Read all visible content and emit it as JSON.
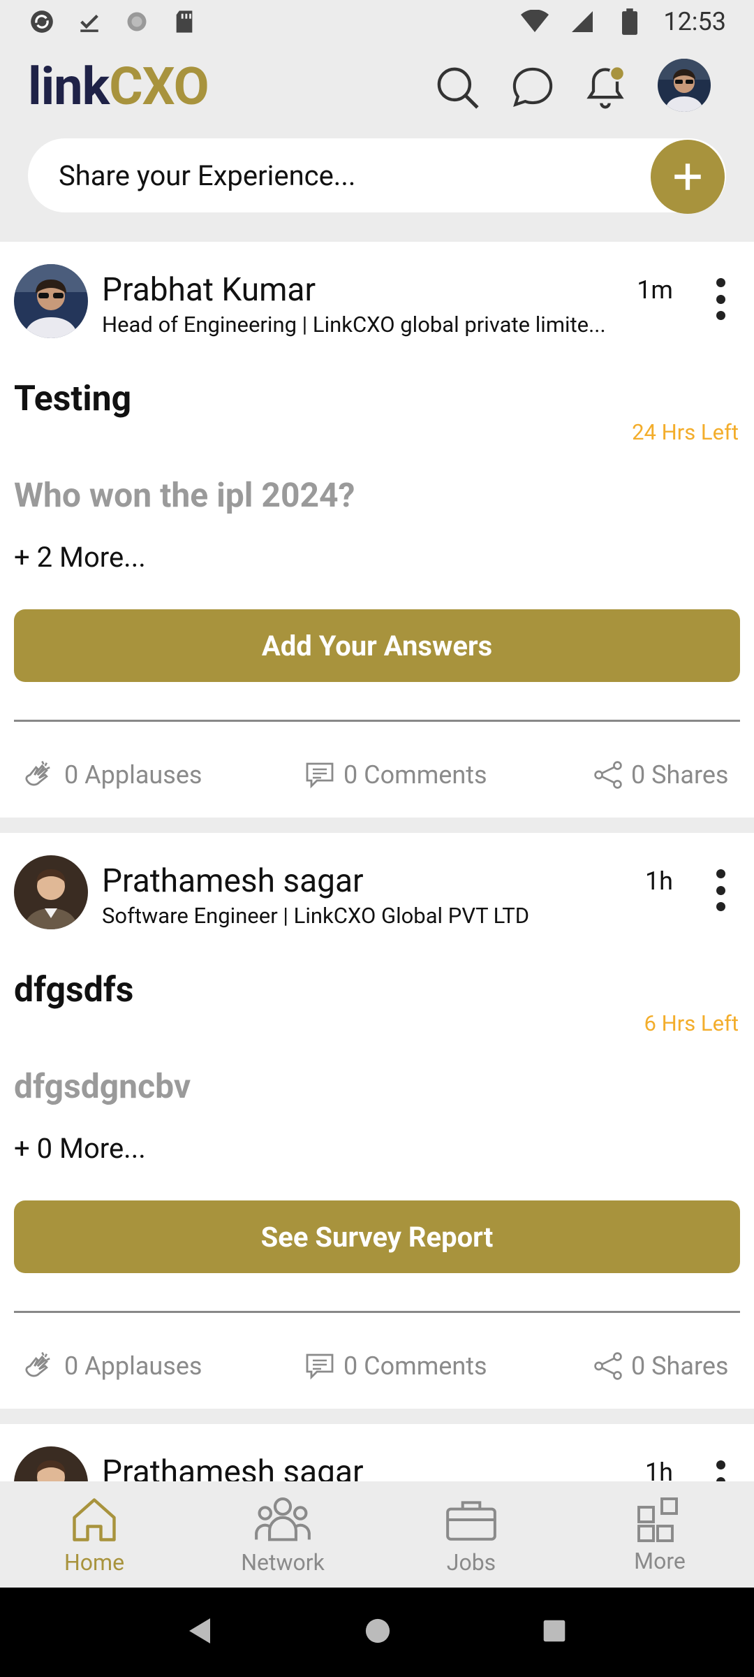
{
  "status_bar": {
    "time": "12:53"
  },
  "header": {
    "logo_left": "link",
    "logo_right": "CXO"
  },
  "share": {
    "placeholder": "Share your Experience..."
  },
  "posts": [
    {
      "author": "Prabhat Kumar",
      "role": "Head of Engineering | LinkCXO global private limite...",
      "ago": "1m",
      "title": "Testing",
      "time_left": "24 Hrs Left",
      "question": "Who won the ipl 2024?",
      "more": "+ 2 More...",
      "cta": "Add Your Answers",
      "applauses": "0 Applauses",
      "comments": "0 Comments",
      "shares": "0 Shares"
    },
    {
      "author": "Prathamesh sagar",
      "role": "Software  Engineer | LinkCXO Global PVT LTD",
      "ago": "1h",
      "title": "dfgsdfs",
      "time_left": "6 Hrs Left",
      "question": "dfgsdgncbv",
      "more": "+ 0 More...",
      "cta": "See Survey Report",
      "applauses": "0 Applauses",
      "comments": "0 Comments",
      "shares": "0 Shares"
    },
    {
      "author": "Prathamesh sagar",
      "ago": "1h"
    }
  ],
  "bottom_nav": {
    "items": [
      {
        "label": "Home",
        "icon": "home-icon",
        "active": true
      },
      {
        "label": "Network",
        "icon": "network-icon",
        "active": false
      },
      {
        "label": "Jobs",
        "icon": "briefcase-icon",
        "active": false
      },
      {
        "label": "More",
        "icon": "grid-icon",
        "active": false
      }
    ]
  },
  "colors": {
    "accent": "#a8933d",
    "navy": "#1f2247",
    "time_left": "#f3ad2b",
    "muted": "#8a8a8a"
  }
}
